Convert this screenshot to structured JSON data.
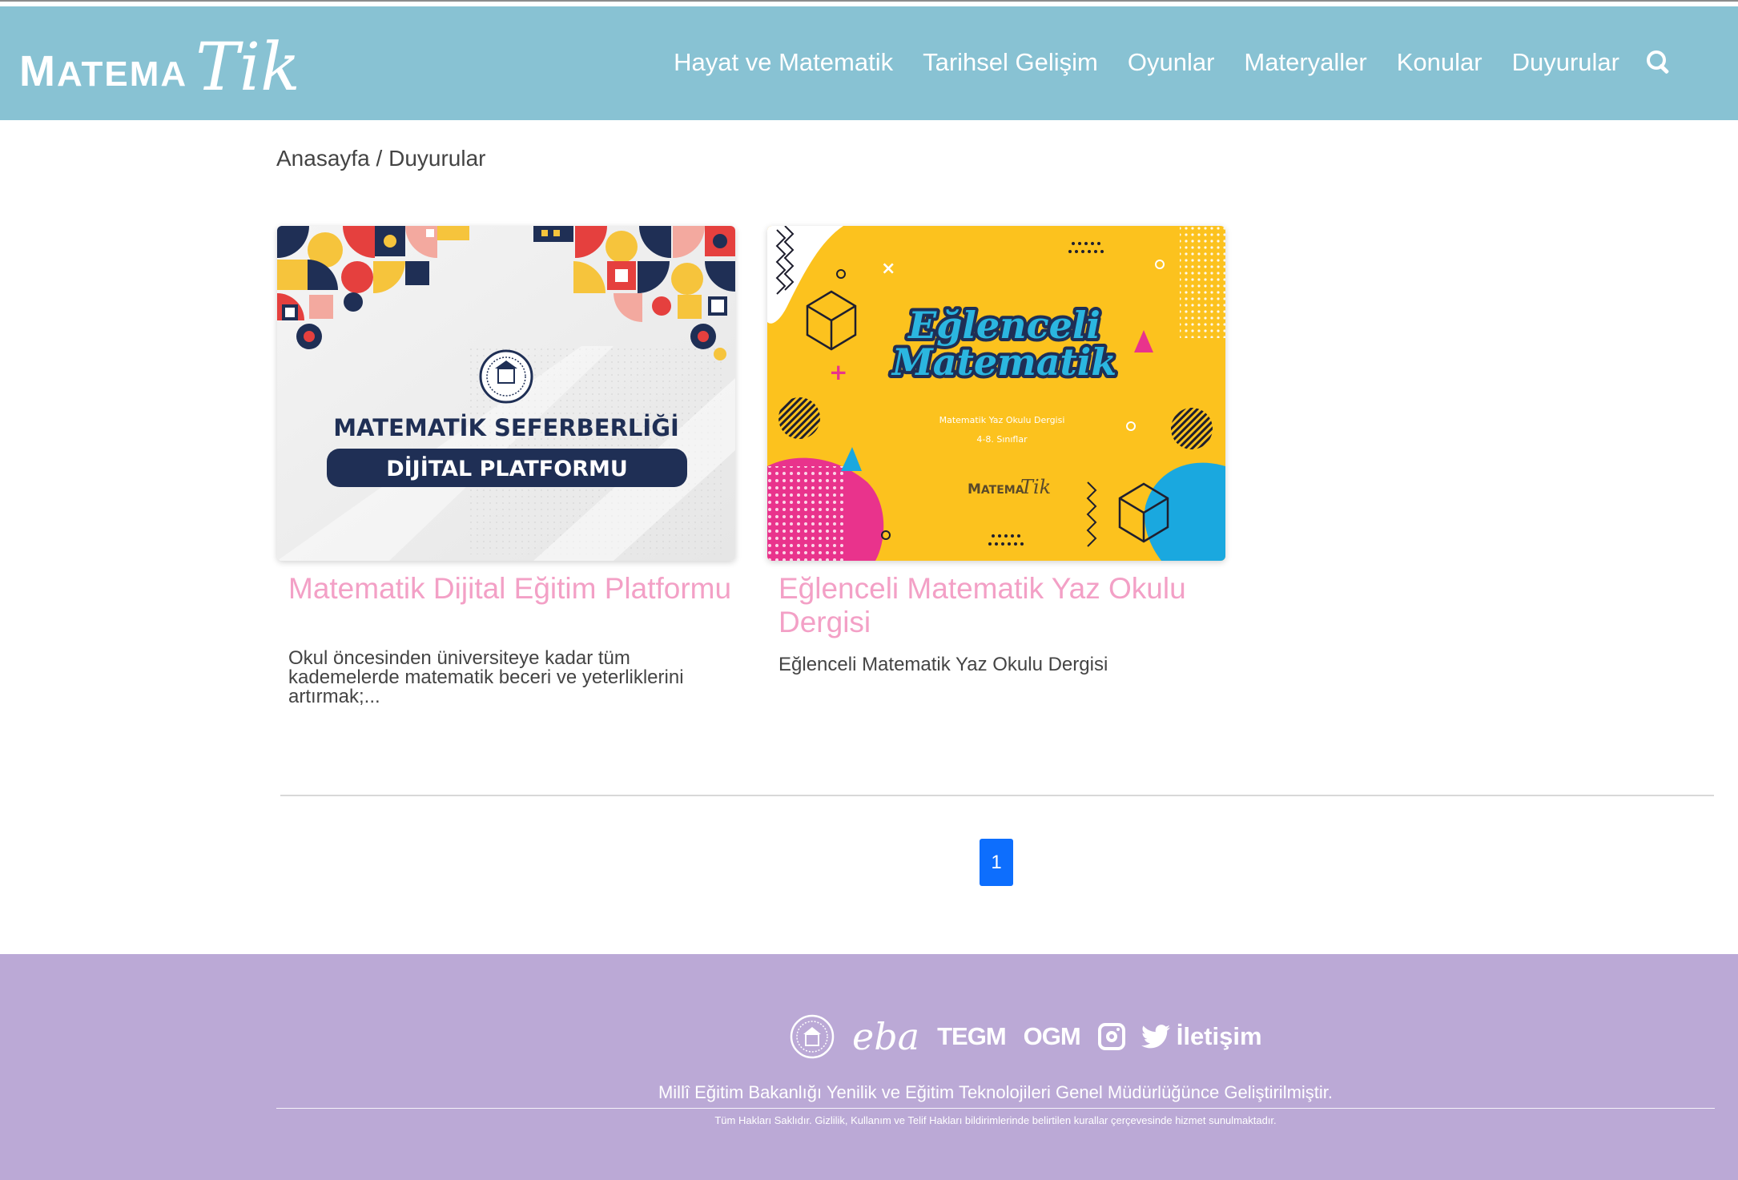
{
  "header": {
    "logo_main": "Matema",
    "logo_script": "Tik",
    "nav": [
      "Hayat ve Matematik",
      "Tarihsel Gelişim",
      "Oyunlar",
      "Materyaller",
      "Konular",
      "Duyurular"
    ],
    "search_icon": "search-icon"
  },
  "breadcrumb": {
    "home": "Anasayfa",
    "separator": " / ",
    "current": "Duyurular"
  },
  "cards": [
    {
      "image": {
        "heading": "MATEMATİK SEFERBERLİĞİ",
        "banner": "DİJİTAL PLATFORMU"
      },
      "title": "Matematik Dijital Eğitim Platformu",
      "description": "Okul öncesinden üniversiteye kadar tüm kademelerde matematik beceri ve yeterliklerini artırmak;..."
    },
    {
      "image": {
        "title_line1": "Eğlenceli",
        "title_line2": "Matematik",
        "subtitle1": "Matematik Yaz Okulu Dergisi",
        "subtitle2": "4-8. Sınıflar",
        "logo_main": "Matema",
        "logo_script": "Tik"
      },
      "title": "Eğlenceli Matematik Yaz Okulu Dergisi",
      "description": "Eğlenceli Matematik Yaz Okulu Dergisi"
    }
  ],
  "pagination": {
    "current": "1"
  },
  "footer": {
    "links": [
      "eba",
      "TEGM",
      "OGM"
    ],
    "contact": "İletişim",
    "developed_by": "Millî Eğitim Bakanlığı Yenilik ve Eğitim Teknolojileri Genel Müdürlüğünce Geliştirilmiştir.",
    "rights": "Tüm Hakları Saklıdır. Gizlilik, Kullanım ve Telif Hakları bildirimlerinde belirtilen kurallar çerçevesinde hizmet sunulmaktadır."
  },
  "colors": {
    "header_bg": "#88c2d3",
    "footer_bg": "#bba9d6",
    "card_title": "#f3a0c6",
    "pagination": "#0d6efd"
  }
}
